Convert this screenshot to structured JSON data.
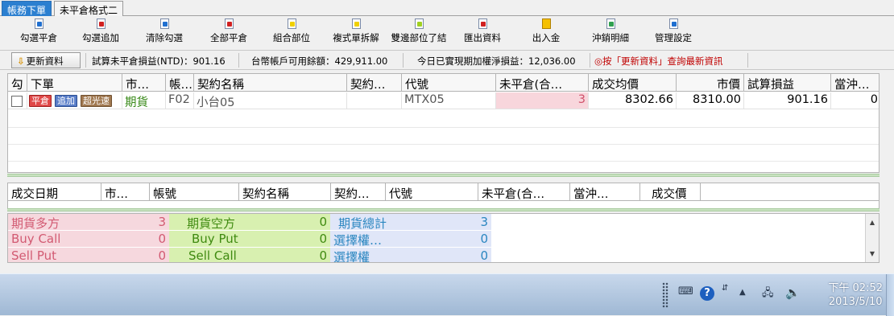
{
  "tabs": [
    {
      "label": "帳務下單",
      "active": true
    },
    {
      "label": "未平倉格式二",
      "active": false
    }
  ],
  "toolbar": [
    {
      "label": "勾選平倉",
      "icon": "close-position-icon",
      "color": "#1f6fd0"
    },
    {
      "label": "勾選追加",
      "icon": "add-position-icon",
      "color": "#d02020"
    },
    {
      "label": "清除勾選",
      "icon": "clear-selection-icon",
      "color": "#1f6fd0"
    },
    {
      "label": "全部平倉",
      "icon": "close-all-icon",
      "color": "#d02020"
    },
    {
      "label": "組合部位",
      "icon": "combine-icon",
      "color": "#f0d000"
    },
    {
      "label": "複式單拆解",
      "icon": "split-order-icon",
      "color": "#f0d000"
    },
    {
      "label": "雙邊部位了結",
      "icon": "settle-icon",
      "color": "#a0d020"
    },
    {
      "label": "匯出資料",
      "icon": "export-icon",
      "color": "#d02020"
    },
    {
      "label": "出入金",
      "icon": "money-icon",
      "color": "#e0a000"
    },
    {
      "label": "沖銷明細",
      "icon": "offset-detail-icon",
      "color": "#30a050"
    },
    {
      "label": "管理設定",
      "icon": "settings-icon",
      "color": "#1f6fd0"
    }
  ],
  "infobar": {
    "refresh_label": "更新資料",
    "unrealized": "試算未平倉損益(NTD)：901.16",
    "available": "台幣帳戶可用餘額：429,911.00",
    "realized": "今日已實現期加權淨損益：12,036.00",
    "hint": "◎按「更新資料」查詢最新資訊"
  },
  "positions": {
    "headers": [
      "勾",
      "下單",
      "市…",
      "帳…",
      "契約名稱",
      "契約…",
      "代號",
      "未平倉(合…",
      "成交均價",
      "市價",
      "試算損益",
      "當沖…"
    ],
    "rows": [
      {
        "buttons": [
          "平倉",
          "追加",
          "超光速"
        ],
        "market": "期貨",
        "account": "F02",
        "contract": "小台05",
        "contract_type": "",
        "code": "MTX05",
        "open_qty": "3",
        "avg_price": "8302.66",
        "market_price": "8310.00",
        "pnl": "901.16",
        "daytrade": "0"
      }
    ]
  },
  "fills": {
    "headers": [
      "成交日期",
      "市…",
      "帳號",
      "契約名稱",
      "契約…",
      "代號",
      "未平倉(合…",
      "當沖…",
      "成交價"
    ]
  },
  "summary": {
    "rows": [
      [
        {
          "label": "期貨多方",
          "value": "3"
        },
        {
          "label": "期貨空方",
          "value": "0"
        },
        {
          "label": "期貨總計",
          "value": "3"
        }
      ],
      [
        {
          "label": "Buy Call",
          "value": "0"
        },
        {
          "label": "Buy Put",
          "value": "0"
        },
        {
          "label": "選擇權…",
          "value": "0"
        }
      ],
      [
        {
          "label": "Sell Put",
          "value": "0"
        },
        {
          "label": "Sell Call",
          "value": "0"
        },
        {
          "label": "選擇權",
          "value": "0"
        }
      ]
    ]
  },
  "taskbar": {
    "time": "下午 02:52",
    "date": "2013/5/10"
  }
}
